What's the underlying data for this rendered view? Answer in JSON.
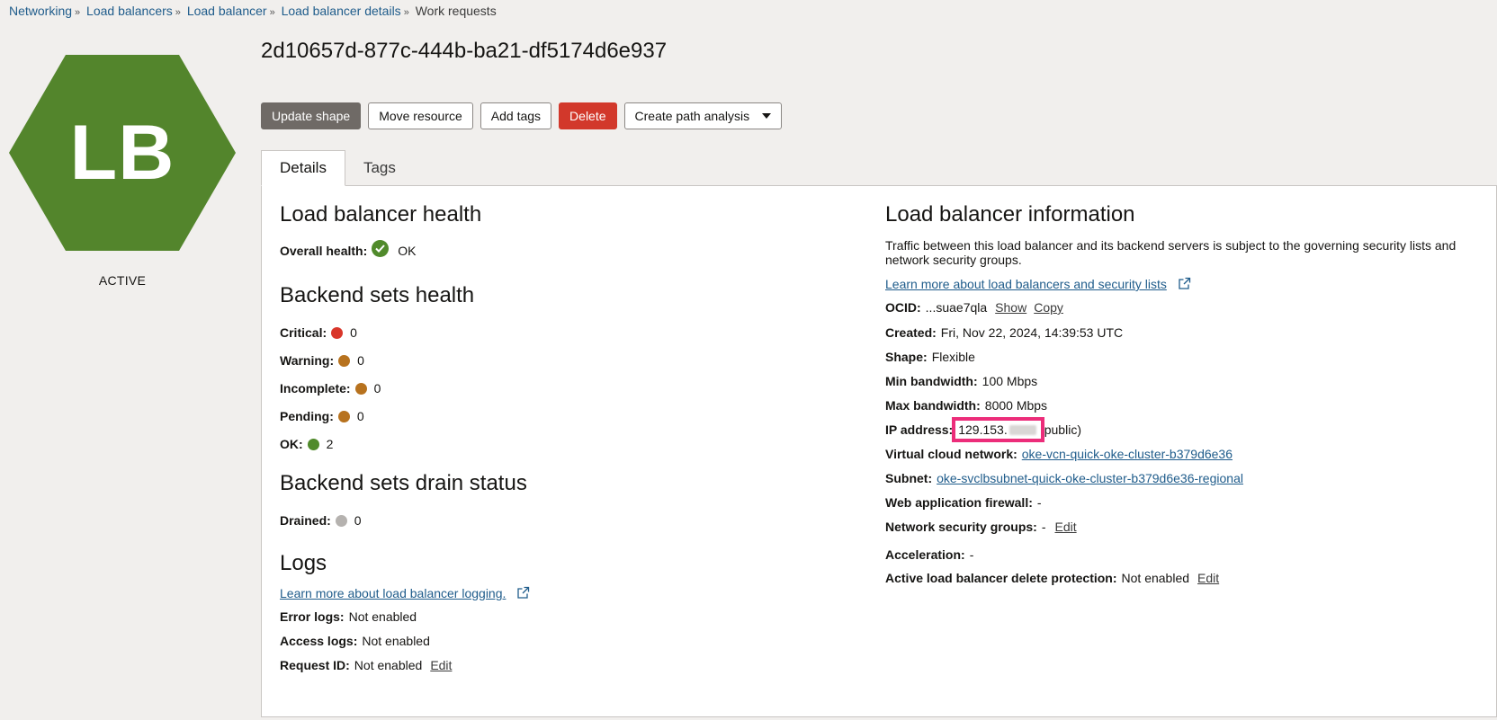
{
  "breadcrumb": {
    "items": [
      "Networking",
      "Load balancers",
      "Load balancer",
      "Load balancer details"
    ],
    "current": "Work requests",
    "separator": "»"
  },
  "emblem": {
    "text": "LB",
    "color": "#53852c",
    "status": "ACTIVE"
  },
  "title": "2d10657d-877c-444b-ba21-df5174d6e937",
  "actions": {
    "update_shape": "Update shape",
    "move_resource": "Move resource",
    "add_tags": "Add tags",
    "delete": "Delete",
    "create_path_analysis": "Create path analysis"
  },
  "tabs": {
    "details": "Details",
    "tags": "Tags"
  },
  "health": {
    "heading": "Load balancer health",
    "overall_label": "Overall health:",
    "overall_value": "OK"
  },
  "backend_health": {
    "heading": "Backend sets health",
    "critical_label": "Critical:",
    "critical_value": "0",
    "warning_label": "Warning:",
    "warning_value": "0",
    "incomplete_label": "Incomplete:",
    "incomplete_value": "0",
    "pending_label": "Pending:",
    "pending_value": "0",
    "ok_label": "OK:",
    "ok_value": "2"
  },
  "drain": {
    "heading": "Backend sets drain status",
    "drained_label": "Drained:",
    "drained_value": "0"
  },
  "logs": {
    "heading": "Logs",
    "learn_more": "Learn more about load balancer logging.",
    "error_label": "Error logs:",
    "error_value": "Not enabled",
    "access_label": "Access logs:",
    "access_value": "Not enabled",
    "request_label": "Request ID:",
    "request_value": "Not enabled",
    "edit": "Edit"
  },
  "info": {
    "heading": "Load balancer information",
    "description": "Traffic between this load balancer and its backend servers is subject to the governing security lists and network security groups.",
    "learn_more": "Learn more about load balancers and security lists",
    "ocid_label": "OCID:",
    "ocid_value": "...suae7qla",
    "show": "Show",
    "copy": "Copy",
    "created_label": "Created:",
    "created_value": "Fri, Nov 22, 2024, 14:39:53 UTC",
    "shape_label": "Shape:",
    "shape_value": "Flexible",
    "min_bw_label": "Min bandwidth:",
    "min_bw_value": "100 Mbps",
    "max_bw_label": "Max bandwidth:",
    "max_bw_value": "8000 Mbps",
    "ip_label": "IP address:",
    "ip_prefix": "129.153.",
    "ip_suffix": "public)",
    "vcn_label": "Virtual cloud network:",
    "vcn_value": "oke-vcn-quick-oke-cluster-b379d6e36",
    "subnet_label": "Subnet:",
    "subnet_value": "oke-svclbsubnet-quick-oke-cluster-b379d6e36-regional",
    "waf_label": "Web application firewall:",
    "waf_value": "-",
    "nsg_label": "Network security groups:",
    "nsg_value": "-",
    "nsg_edit": "Edit",
    "accel_label": "Acceleration:",
    "accel_value": "-",
    "protect_label": "Active load balancer delete protection:",
    "protect_value": "Not enabled",
    "protect_edit": "Edit"
  }
}
